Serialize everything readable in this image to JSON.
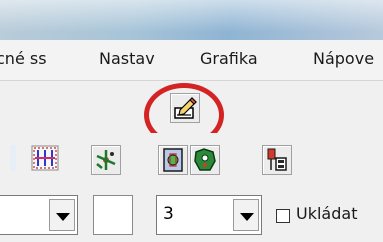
{
  "menu": {
    "items": [
      {
        "label": "cné ss"
      },
      {
        "label": "Nastav"
      },
      {
        "label": "Grafika"
      },
      {
        "label": "Nápove"
      }
    ]
  },
  "toolbar_top": {
    "highlighted_button": {
      "icon": "edit-pencil-icon"
    }
  },
  "toolbar_icons": [
    {
      "icon": "grid-select-icon"
    },
    {
      "icon": "network-nodes-icon"
    },
    {
      "icon": "component-box-icon"
    },
    {
      "icon": "green-shape-icon"
    },
    {
      "icon": "device-stack-icon"
    }
  ],
  "options_row": {
    "combo1_value": "",
    "field_value": "",
    "combo2_value": "3",
    "checkbox_label": "Ukládat",
    "checkbox_checked": false
  },
  "colors": {
    "highlight_ring": "#d42323",
    "menubar_bg": "#f3f3f3"
  }
}
